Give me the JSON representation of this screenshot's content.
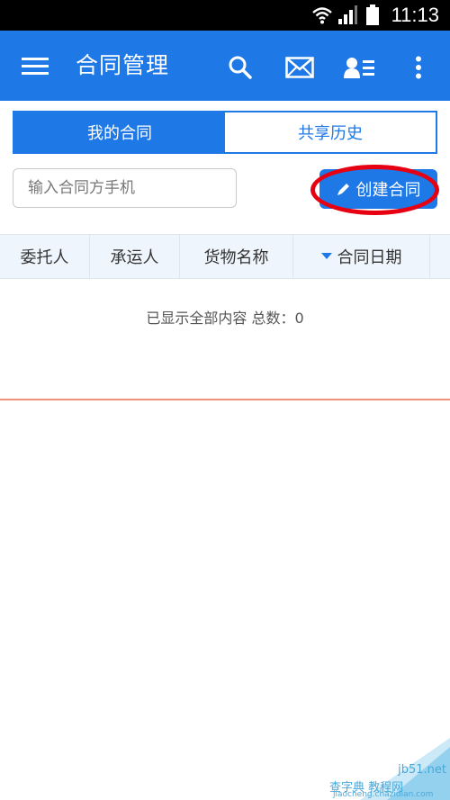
{
  "status_bar": {
    "time": "11:13",
    "icons": [
      "wifi-icon",
      "signal-icon",
      "battery-icon"
    ]
  },
  "app_bar": {
    "title": "合同管理",
    "icons": [
      "menu-icon",
      "search-icon",
      "mail-icon",
      "contacts-icon",
      "more-icon"
    ]
  },
  "tabs": [
    {
      "label": "我的合同",
      "active": true
    },
    {
      "label": "共享历史",
      "active": false
    }
  ],
  "search": {
    "placeholder": "输入合同方手机",
    "value": ""
  },
  "create_button": {
    "label": "创建合同",
    "icon": "pencil-icon"
  },
  "table": {
    "columns": [
      "委托人",
      "承运人",
      "货物名称",
      "合同日期"
    ],
    "sort_icon": "sort-down-icon"
  },
  "summary": "已显示全部内容 总数：0",
  "watermark": {
    "line1": "jb51.net",
    "line2": "查字典 教程网",
    "line3": "jiaocheng.chazidian.com"
  },
  "colors": {
    "primary": "#1e78e6",
    "highlight": "#e60012",
    "divider": "#f08f7a"
  }
}
